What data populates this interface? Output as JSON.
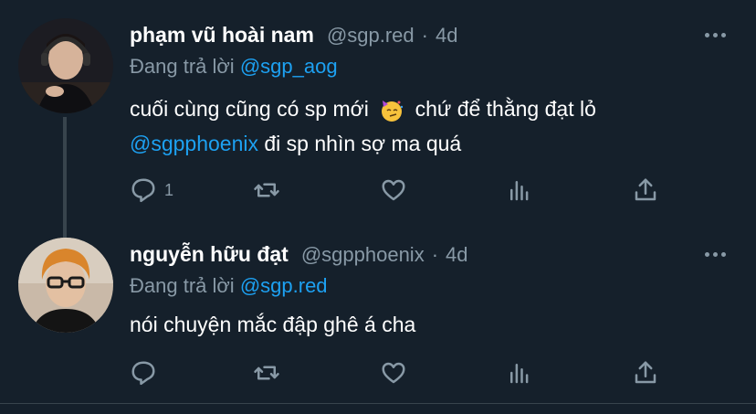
{
  "tweets": [
    {
      "name": "phạm vũ hoài nam",
      "handle": "@sgp.red",
      "time": "4d",
      "reply_prefix": "Đang trả lời",
      "reply_to": "@sgp_aog",
      "text_line1_a": "cuối cùng cũng có sp mới",
      "text_line1_b": "chứ để thằng đạt lỏ",
      "text_line2_mention": "@sgpphoenix",
      "text_line2_rest": " đi sp nhìn sợ ma quá",
      "reply_count": "1",
      "emoji_icon": "partying-face-icon"
    },
    {
      "name": "nguyễn hữu đạt",
      "handle": "@sgpphoenix",
      "time": "4d",
      "reply_prefix": "Đang trả lời",
      "reply_to": "@sgp.red",
      "text": "nói chuyện mắc đập ghê á cha",
      "reply_count": ""
    }
  ],
  "separator": "·",
  "colors": {
    "background": "#15202b",
    "secondary": "#8899a6",
    "link": "#1da1f2",
    "border": "#38444d"
  }
}
